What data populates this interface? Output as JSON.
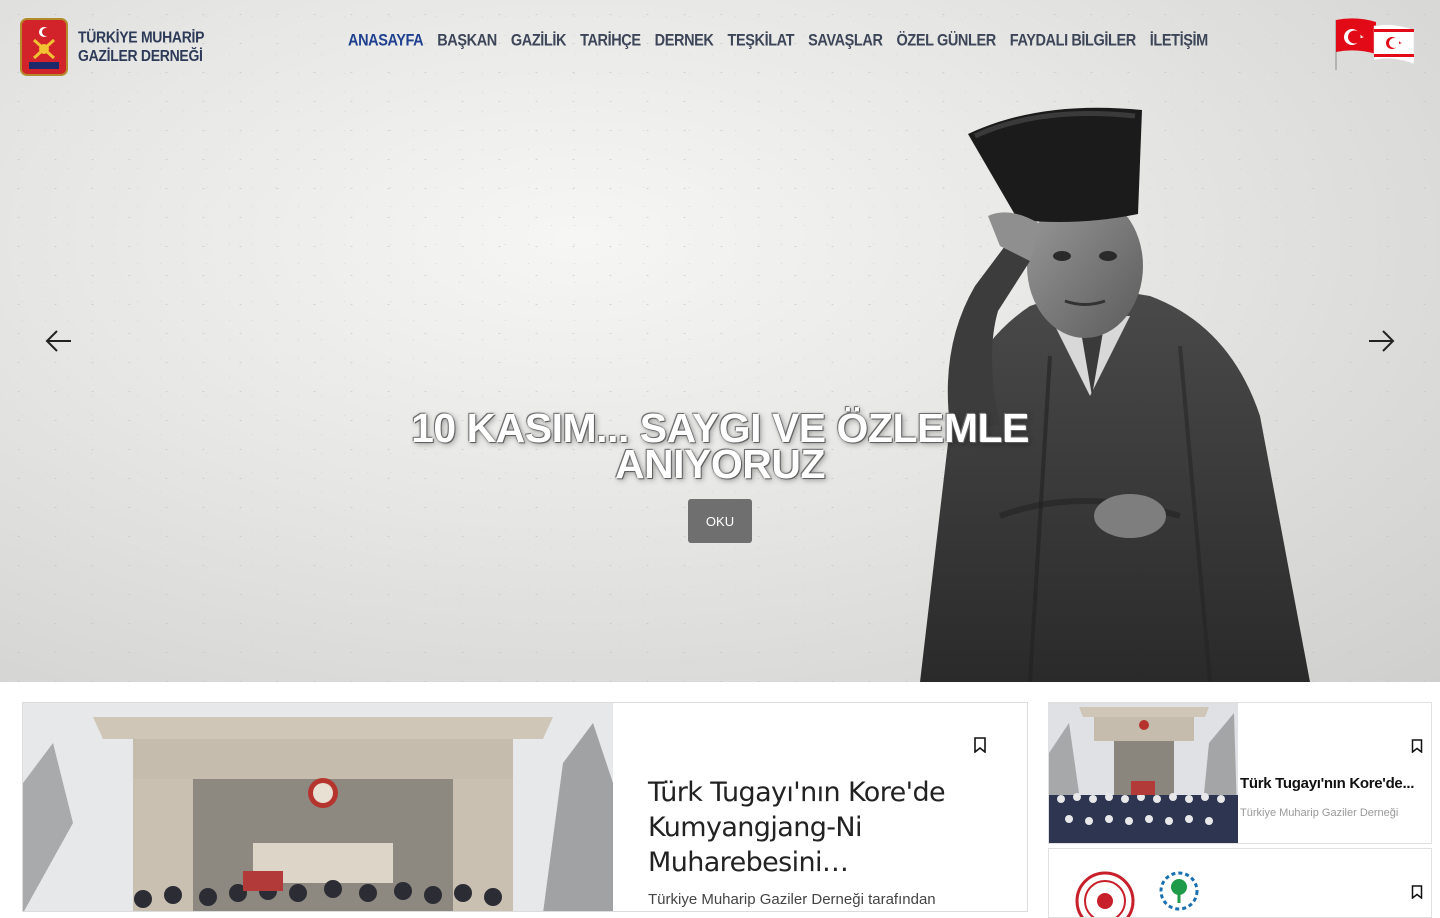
{
  "brand": {
    "line1": "TÜRKİYE MUHARİP",
    "line2": "GAZİLER DERNEĞİ",
    "logo_text": "MUHARİP GAZİ"
  },
  "nav": {
    "items": [
      {
        "label": "ANASAYFA",
        "active": true
      },
      {
        "label": "BAŞKAN",
        "active": false
      },
      {
        "label": "GAZİLİK",
        "active": false
      },
      {
        "label": "TARİHÇE",
        "active": false
      },
      {
        "label": "DERNEK",
        "active": false
      },
      {
        "label": "TEŞKİLAT",
        "active": false
      },
      {
        "label": "SAVAŞLAR",
        "active": false
      },
      {
        "label": "ÖZEL GÜNLER",
        "active": false
      },
      {
        "label": "FAYDALI BİLGİLER",
        "active": false
      },
      {
        "label": "İLETİŞİM",
        "active": false
      }
    ]
  },
  "hero": {
    "title_line1": "10 KASIM... SAYGI VE ÖZLEMLE",
    "title_line2": "ANIYORUZ",
    "button_label": "OKU"
  },
  "featured": {
    "title": "Türk Tugayı'nın Kore'de Kumyangjang-Ni Muharebesini…",
    "excerpt": "Türkiye Muharip Gaziler Derneği tarafından"
  },
  "side_cards": [
    {
      "title": "Türk Tugayı'nın Kore'de...",
      "meta": "Türkiye Muharip Gaziler Derneği"
    }
  ],
  "colors": {
    "nav_text": "#3d4658",
    "nav_active": "#1f3f8f",
    "brand_text": "#2d3b58",
    "hero_button": "#6f6f6f",
    "flag_red": "#e30a17"
  }
}
